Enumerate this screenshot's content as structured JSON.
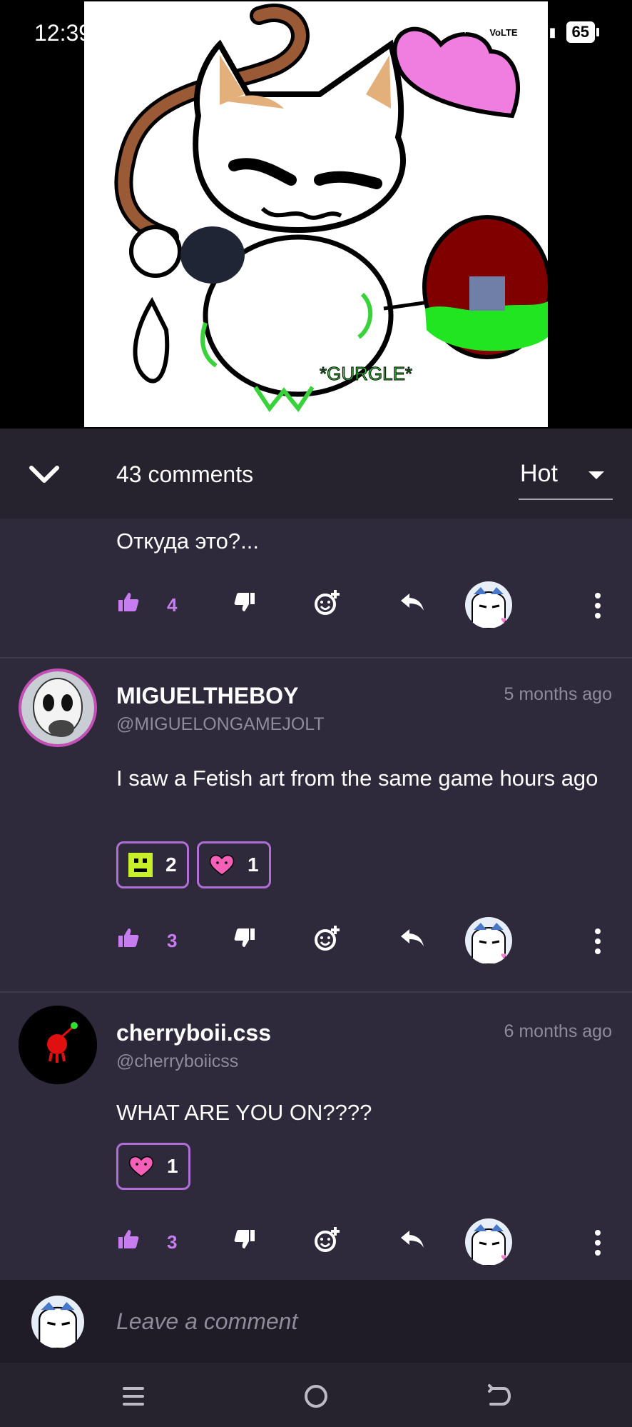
{
  "status_bar": {
    "time": "12:39",
    "network": "VoLTE",
    "sim_slot": "2",
    "battery": "65"
  },
  "header": {
    "comments_count": "43 comments",
    "sort_value": "Hot"
  },
  "comments": [
    {
      "text": "Откуда это?...",
      "likes": "4"
    },
    {
      "username": "MIGUELTHEBOY",
      "handle": "@MIGUELONGAMEJOLT",
      "timestamp": "5 months ago",
      "text": "I saw a Fetish art from the same game hours ago",
      "reactions": [
        {
          "icon": "pixel-face-icon",
          "count": "2"
        },
        {
          "icon": "heart-face-icon",
          "count": "1"
        }
      ],
      "likes": "3"
    },
    {
      "username": "cherryboii.css",
      "handle": "@cherryboiicss",
      "timestamp": "6 months ago",
      "text": "WHAT ARE YOU ON????",
      "reactions": [
        {
          "icon": "heart-face-icon",
          "count": "1"
        }
      ],
      "likes": "3"
    }
  ],
  "artwork": {
    "caption": "*GURGLE*"
  },
  "input": {
    "placeholder": "Leave a comment"
  },
  "colors": {
    "accent": "#c77df0",
    "reaction_border": "#b06fd6",
    "panel_bg": "#2e2a3b",
    "header_bg": "#26232f"
  }
}
